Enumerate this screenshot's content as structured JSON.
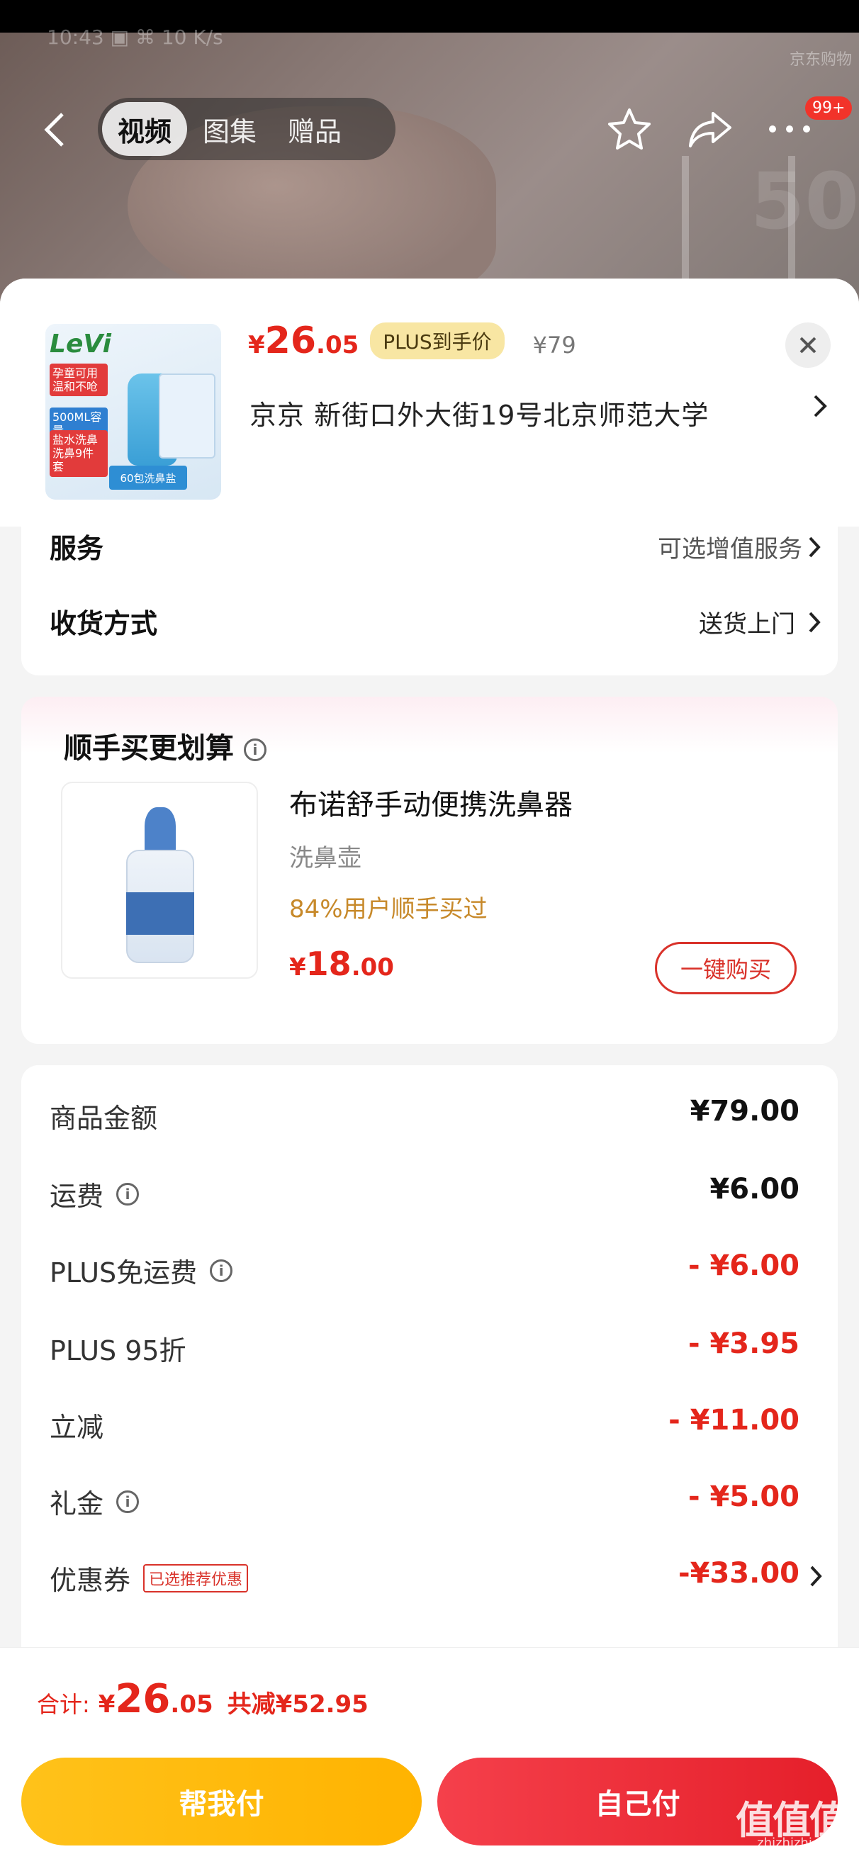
{
  "status": {
    "time_text": "10:43 ▣ ⌘ 10 K/s"
  },
  "watermark_top": "京东购物",
  "top_bar": {
    "tabs": [
      {
        "label": "视频",
        "active": true
      },
      {
        "label": "图集",
        "active": false
      },
      {
        "label": "赠品",
        "active": false
      }
    ],
    "badge": "99+"
  },
  "product": {
    "brand": "LeVi",
    "tags": [
      "孕童可用 温和不呛",
      "500ML容量",
      "盐水洗鼻 洗鼻9件套"
    ],
    "pack_label": "60包洗鼻盐",
    "price_currency": "¥",
    "price_int": "26",
    "price_dec": ".05",
    "plus_label": "PLUS到手价",
    "original_price": "¥79",
    "address": "京京   新街口外大街19号北京师范大学"
  },
  "options": {
    "service_label": "服务",
    "service_value": "可选增值服务",
    "delivery_label": "收货方式",
    "delivery_value": "送货上门"
  },
  "upsell": {
    "title": "顺手买更划算",
    "name": "布诺舒手动便携洗鼻器",
    "subtitle": "洗鼻壶",
    "stat": "84%用户顺手买过",
    "price_currency": "¥",
    "price_int": "18",
    "price_dec": ".00",
    "buy_label": "一键购买"
  },
  "fees": [
    {
      "label": "商品金额",
      "value": "¥79.00",
      "red": false,
      "info": false
    },
    {
      "label": "运费",
      "value": "¥6.00",
      "red": false,
      "info": true
    },
    {
      "label": "PLUS免运费",
      "value": "- ¥6.00",
      "red": true,
      "info": true
    },
    {
      "label": "PLUS 95折",
      "value": "- ¥3.95",
      "red": true,
      "info": false
    },
    {
      "label": "立减",
      "value": "- ¥11.00",
      "red": true,
      "info": false
    },
    {
      "label": "礼金",
      "value": "- ¥5.00",
      "red": true,
      "info": true
    },
    {
      "label": "优惠券",
      "value": "-¥33.00",
      "red": true,
      "info": false,
      "tag": "已选推荐优惠"
    }
  ],
  "bottom": {
    "total_label": "合计:",
    "total_currency": "¥",
    "total_int": "26",
    "total_dec": ".05",
    "saved": "共减¥52.95",
    "pay_other": "帮我付",
    "pay_self": "自己付"
  },
  "site_watermark": {
    "mark": "值值值",
    "url": "zhizhizhi.com"
  },
  "colors": {
    "accent_red": "#e4261b",
    "plus_gold": "#f8e6a3",
    "yellow_btn": "#ffb300"
  }
}
